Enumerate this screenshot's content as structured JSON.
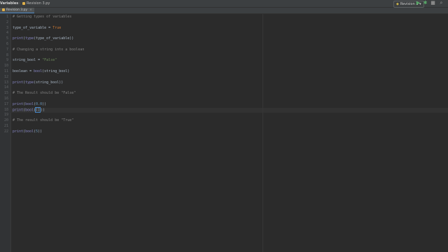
{
  "titlebar": {
    "project": "Variables",
    "separator": "›",
    "file": "Revision 3.py",
    "run_config": "Revision 3",
    "run_dropdown": "▾",
    "play_icon": "▶",
    "debug_icon": "✱",
    "stop_icon": "■",
    "search_icon": "⌕"
  },
  "tabbar": {
    "active_tab": "Revision 3.py",
    "close": "×"
  },
  "colors": {
    "background": "#2b2b2b",
    "comment": "#808080",
    "string": "#6a8759",
    "keyword": "#cc7832",
    "number": "#6897bb",
    "text": "#a9b7c6"
  },
  "editor": {
    "lines": [
      {
        "num": "1",
        "text": "# Getting types of variables"
      },
      {
        "num": "2",
        "text": ""
      },
      {
        "num": "3",
        "text": "type_of_variable = True"
      },
      {
        "num": "4",
        "text": ""
      },
      {
        "num": "5",
        "text": "print(type(type_of_variable))"
      },
      {
        "num": "6",
        "text": ""
      },
      {
        "num": "7",
        "text": "# Changing a string into a boolean"
      },
      {
        "num": "8",
        "text": ""
      },
      {
        "num": "9",
        "text": "string_bool = \"False\""
      },
      {
        "num": "10",
        "text": ""
      },
      {
        "num": "11",
        "text": "boolean = bool(string_bool)"
      },
      {
        "num": "12",
        "text": ""
      },
      {
        "num": "13",
        "text": "print(type(string_bool))"
      },
      {
        "num": "14",
        "text": ""
      },
      {
        "num": "15",
        "text": "# The Result should be \"False\""
      },
      {
        "num": "16",
        "text": ""
      },
      {
        "num": "17",
        "text": "print(bool(0.0))"
      },
      {
        "num": "18",
        "text": "print(bool([]))"
      },
      {
        "num": "19",
        "text": ""
      },
      {
        "num": "20",
        "text": "# The result should be \"True\""
      },
      {
        "num": "21",
        "text": ""
      },
      {
        "num": "22",
        "text": "print(bool(5))"
      }
    ],
    "current_line": 18
  }
}
